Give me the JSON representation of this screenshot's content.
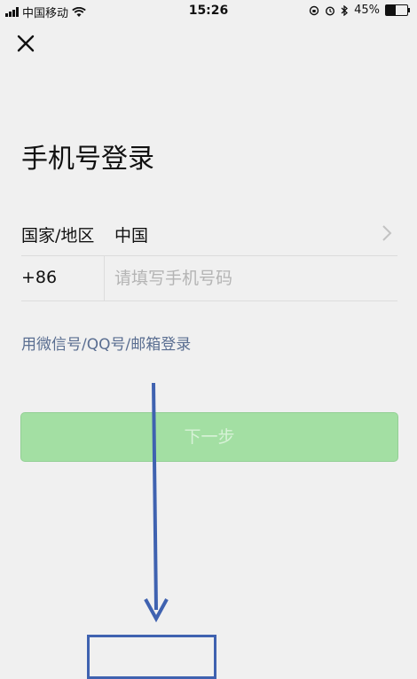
{
  "status_bar": {
    "carrier": "中国移动",
    "time": "15:26",
    "battery_percent": "45%",
    "battery_level": 0.45
  },
  "page": {
    "title": "手机号登录"
  },
  "region_row": {
    "label": "国家/地区",
    "value": "中国"
  },
  "phone_row": {
    "country_code": "+86",
    "placeholder": "请填写手机号码",
    "value": ""
  },
  "alt_login_link": "用微信号/QQ号/邮箱登录",
  "next_button": "下一步",
  "colors": {
    "button_bg": "#a3dfa3",
    "link": "#5a6e91",
    "annotation": "#3f62b0"
  }
}
